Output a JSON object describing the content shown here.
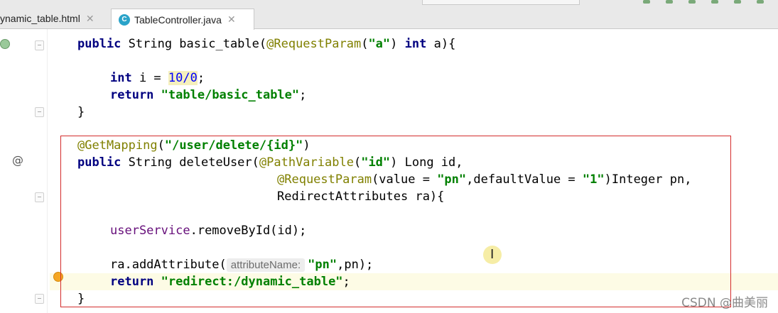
{
  "tabs": [
    {
      "label": "ynamic_table.html",
      "active": false
    },
    {
      "label": "TableController.java",
      "active": true,
      "icon_letter": "C"
    }
  ],
  "code": {
    "l1_pub": "public",
    "l1_type": " String basic_table(",
    "l1_ann": "@RequestParam",
    "l1_str": "\"a\"",
    "l1_int": "int",
    "l1_end": " a){",
    "l2_int": "int",
    "l2_mid": " i = ",
    "l2_num": "10/0",
    "l2_end": ";",
    "l3_ret": "return",
    "l3_str": "\"table/basic_table\"",
    "l3_end": ";",
    "l4": "}",
    "l5_ann": "@GetMapping",
    "l5_str": "\"/user/delete/{id}\"",
    "l6_pub": "public",
    "l6_mid": " String deleteUser(",
    "l6_ann": "@PathVariable",
    "l6_str": "\"id\"",
    "l6_end": ") Long id,",
    "l7_ann": "@RequestParam",
    "l7_a": "(value = ",
    "l7_str1": "\"pn\"",
    "l7_b": ",defaultValue = ",
    "l7_str2": "\"1\"",
    "l7_end": ")Integer pn,",
    "l8": "RedirectAttributes ra){",
    "l9_field": "userService",
    "l9_end": ".removeById(id);",
    "l10_a": "ra.addAttribute(",
    "l10_hint": "attributeName:",
    "l10_str": "\"pn\"",
    "l10_end": ",pn);",
    "l11_ret": "return",
    "l11_str": "\"redirect:/dynamic_table\"",
    "l11_end": ";",
    "l12": "}"
  },
  "gutter": {
    "annotation_marker": "@"
  },
  "watermark": "CSDN @曲美丽",
  "colors": {
    "highlight_box": "#d42c2c",
    "keyword": "#000080",
    "string": "#008000",
    "annotation": "#808000"
  }
}
